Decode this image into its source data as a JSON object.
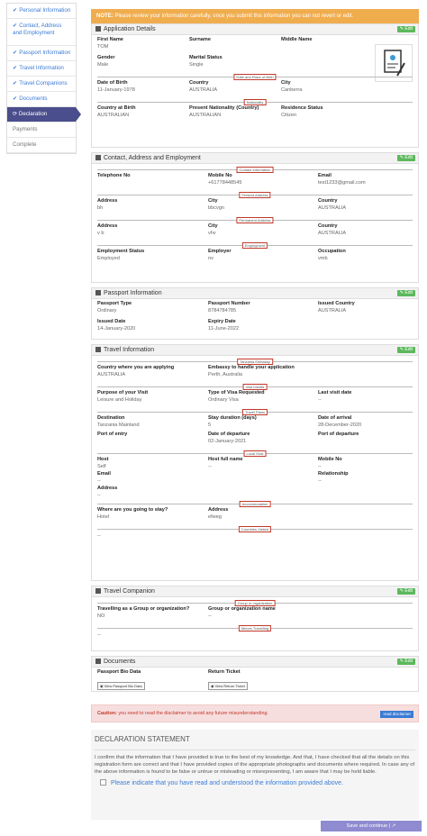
{
  "sidebar": {
    "items": [
      {
        "label": "Personal Information",
        "done": true
      },
      {
        "label": "Contact, Address and Employment",
        "done": true
      },
      {
        "label": "Passport Information",
        "done": true
      },
      {
        "label": "Travel Information",
        "done": true
      },
      {
        "label": "Travel Companions",
        "done": true
      },
      {
        "label": "Documents",
        "done": true
      },
      {
        "label": "Declaration",
        "active": true
      },
      {
        "label": "Payments"
      },
      {
        "label": "Complete"
      }
    ]
  },
  "note": {
    "prefix": "NOTE:",
    "text": "Please review your information carefully, once you submit this information you can not revert or edit."
  },
  "edit_label": "Edit",
  "app": {
    "title": "Application Details",
    "first_name_label": "First Name",
    "first_name": "TOM",
    "surname_label": "Surname",
    "surname": "",
    "middle_name_label": "Middle Name",
    "middle_name": "",
    "gender_label": "Gender",
    "gender": "Male",
    "marital_label": "Marital Status",
    "marital": "Single",
    "div_birth": "Date and Place of Birth",
    "dob_label": "Date of Birth",
    "dob": "11-January-1978",
    "country_label": "Country",
    "country": "AUSTRALIA",
    "city_label": "City",
    "city": "Canberra",
    "div_nat": "Nationality",
    "cob_label": "Country at Birth",
    "cob": "AUSTRALIAN",
    "nat_label": "Present Nationality (Country)",
    "nat": "AUSTRALIAN",
    "res_label": "Residence Status",
    "res": "Citizen"
  },
  "contact": {
    "title": "Contact, Address and Employment",
    "div_contact": "Contact Information",
    "tel_label": "Telephone No",
    "tel": "",
    "mob_label": "Mobile No",
    "mob": "+61778448545",
    "email_label": "Email",
    "email": "test1233@gmail.com",
    "div_present": "Present Address",
    "addr1_label": "Address",
    "addr1": "bh",
    "city1_label": "City",
    "city1": "bbcvgn",
    "country1_label": "Country",
    "country1": "AUSTRALIA",
    "div_perm": "Permanent Address",
    "addr2_label": "Address",
    "addr2": "v b",
    "city2_label": "City",
    "city2": "vhv",
    "country2_label": "Country",
    "country2": "AUSTRALIA",
    "div_emp": "Employment",
    "emp_status_label": "Employment Status",
    "emp_status": "Employed",
    "employer_label": "Employer",
    "employer": "nv",
    "occ_label": "Occupation",
    "occ": "vmb"
  },
  "passport": {
    "title": "Passport Information",
    "type_label": "Passport Type",
    "type": "Ordinary",
    "num_label": "Passport Number",
    "num": "8784784785",
    "ic_label": "Issued Country",
    "ic": "AUSTRALIA",
    "idate_label": "Issued Date",
    "idate": "14-January-2020",
    "exp_label": "Expiry Date",
    "exp": "11-June-2022"
  },
  "travel": {
    "title": "Travel Information",
    "div_emb": "Tanzania Embassy",
    "apply_label": "Country where you are applying",
    "apply": "AUSTRALIA",
    "emb_label": "Embassy to handle your application",
    "emb": "Perth, Australia",
    "div_visa": "Visit Details",
    "purpose_label": "Purpose of your Visit",
    "purpose": "Leisure and Holiday",
    "vtype_label": "Type of Visa Requested",
    "vtype": "Ordinary Visa",
    "last_label": "Last visit date",
    "last": "--",
    "div_plans": "Travel Plans",
    "dest_label": "Destination",
    "dest": "Tanzania Mainland",
    "stay_label": "Stay duration (days)",
    "stay": "5",
    "arr_label": "Date of arrival",
    "arr": "28-December-2020",
    "poe_label": "Port of entry",
    "poe": "",
    "dod_label": "Date of departure",
    "dod": "02-January-2021",
    "pod_label": "Port of departure",
    "pod": "",
    "div_host": "Local Host",
    "host_label": "Host",
    "host": "Self",
    "hostfull_label": "Host full name",
    "hostfull": "--",
    "hostmob_label": "Mobile No",
    "hostmob": "--",
    "hemail_label": "Email",
    "hemail": "--",
    "rel_label": "Relationship",
    "rel": "--",
    "haddr_label": "Address",
    "haddr": "--",
    "div_acc": "Accommodation",
    "where_label": "Where are you going to stay?",
    "where": "Hotel",
    "aaddr_label": "Address",
    "aaddr": "efweg",
    "div_visited": "Countries Visited",
    "visited": "--"
  },
  "companion": {
    "title": "Travel Companion",
    "div_group": "Group or organization",
    "tg_label": "Travelling as a Group or organization?",
    "tg": "NO",
    "gname_label": "Group or organization name",
    "gname": "--",
    "div_minors": "Minors Travelling",
    "minors": "--"
  },
  "documents": {
    "title": "Documents",
    "bio_label": "Passport Bio Data",
    "bio_btn": "View Passport Bio Data",
    "ticket_label": "Return Ticket",
    "ticket_btn": "View Return Ticket"
  },
  "caution": {
    "prefix": "Caution:",
    "text": "you need to read the disclaimer to avoid any future misunderstanding.",
    "button": "read disclaimer"
  },
  "declaration": {
    "title": "DECLARATION STATEMENT",
    "text": "I confirm that the information that I have provided is true to the best of my knowledge. And that, I have checked that all the details on this registration form are correct and that I have provided copies of the appropriate photographs and documents where required. In case any of the above information is found to be false or untrue or misleading or misrepresenting, I am aware that I may be held liable.",
    "check_label": "Please indicate that you have read and understood the information provided above."
  },
  "save_label": "Save and continue |"
}
